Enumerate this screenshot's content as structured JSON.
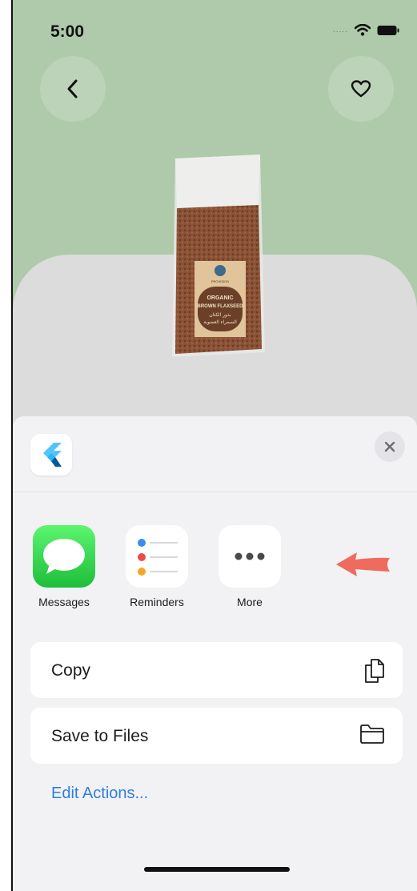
{
  "status_bar": {
    "time": "5:00",
    "signal": "....."
  },
  "share_sheet": {
    "apps": [
      {
        "label": "Messages",
        "icon": "messages-icon"
      },
      {
        "label": "Reminders",
        "icon": "reminders-icon"
      },
      {
        "label": "More",
        "icon": "more-icon"
      }
    ],
    "actions": [
      {
        "label": "Copy",
        "icon": "copy-icon"
      },
      {
        "label": "Save to Files",
        "icon": "folder-icon"
      }
    ],
    "edit_actions": "Edit Actions..."
  },
  "product": {
    "label_line1": "ORGANIC",
    "label_line2": "BROWN FLAXSEED",
    "label_arabic_1": "بذور الكتان",
    "label_arabic_2": "السمراء العضوية"
  },
  "colors": {
    "header_bg": "#aecaaa",
    "card_bg": "#dcdcdc",
    "sheet_bg": "#f2f2f4",
    "link": "#2e7de1",
    "arrow": "#ee6b5e"
  }
}
